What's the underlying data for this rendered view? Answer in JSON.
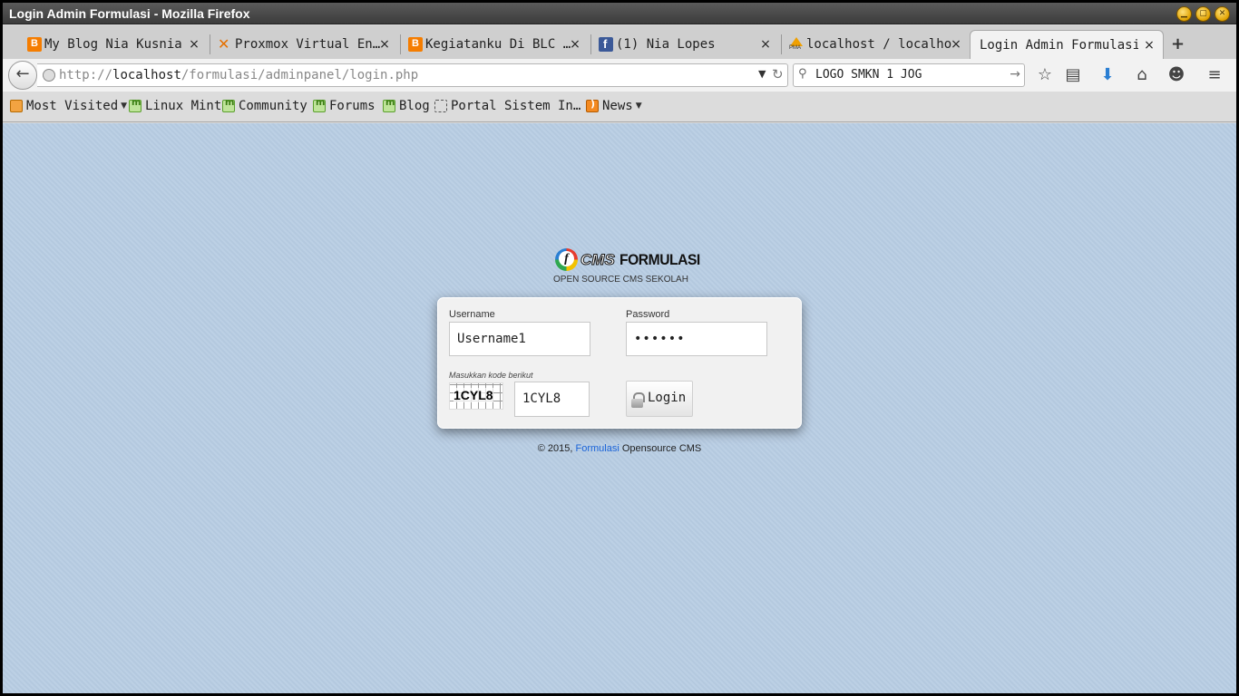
{
  "window": {
    "title": "Login Admin Formulasi - Mozilla Firefox",
    "controls": {
      "minimize": "▁",
      "maximize": "▢",
      "close": "✕"
    }
  },
  "tabs": [
    {
      "label": "My Blog Nia Kusnia …",
      "favicon": "blogger-icon"
    },
    {
      "label": "Proxmox Virtual En…",
      "favicon": "proxmox-icon"
    },
    {
      "label": "Kegiatanku Di BLC …",
      "favicon": "blogger-icon"
    },
    {
      "label": "(1) Nia Lopes",
      "favicon": "facebook-icon"
    },
    {
      "label": "localhost / localhost…",
      "favicon": "phpmyadmin-icon"
    },
    {
      "label": "Login Admin Formulasi",
      "favicon": "none",
      "active": true
    }
  ],
  "tab_close_glyph": "×",
  "new_tab_glyph": "+",
  "navbar": {
    "back_glyph": "←",
    "url_scheme": "http://",
    "url_host": "localhost",
    "url_path": "/formulasi/adminpanel/login.php",
    "dropdown_glyph": "▼",
    "reload_glyph": "↻",
    "search_glyph": "⚲",
    "search_value": "LOGO SMKN 1 JOG",
    "search_go_glyph": "→",
    "icons": [
      "star-icon",
      "reading-list-icon",
      "download-icon",
      "home-icon",
      "chat-icon",
      "menu-icon"
    ]
  },
  "bookmarks": [
    {
      "label": "Most Visited",
      "icon": "folder-icon",
      "dropdown": true
    },
    {
      "label": "Linux Mint",
      "icon": "mint-icon"
    },
    {
      "label": "Community",
      "icon": "mint-icon"
    },
    {
      "label": "Forums",
      "icon": "mint-icon"
    },
    {
      "label": "Blog",
      "icon": "mint-icon"
    },
    {
      "label": "Portal Sistem In…",
      "icon": "blank-page-icon"
    },
    {
      "label": "News",
      "icon": "rss-icon",
      "dropdown": true
    }
  ],
  "bookmark_arrow": "▼",
  "logo": {
    "cms": "CMS",
    "formulasi": "FORMULASI",
    "tagline": "OPEN SOURCE CMS SEKOLAH"
  },
  "login": {
    "username_label": "Username",
    "username_value": "Username1",
    "password_label": "Password",
    "password_value": "••••••",
    "captcha_label": "Masukkan kode berikut",
    "captcha_image_text": "1CYL8",
    "captcha_value": "1CYL8",
    "button_label": "Login"
  },
  "footer": {
    "prefix": "© 2015, ",
    "link": "Formulasi",
    "suffix": " Opensource CMS"
  },
  "colors": {
    "page_background": "#b8cde3",
    "link": "#1a63d8",
    "titlebar": "#4a4a4a"
  }
}
